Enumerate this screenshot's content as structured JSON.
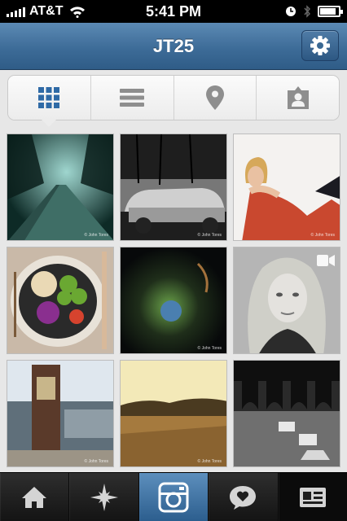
{
  "status_bar": {
    "carrier": "AT&T",
    "time": "5:41 PM",
    "battery_level": 0.85
  },
  "nav": {
    "title": "JT25",
    "settings_icon": "gear-icon"
  },
  "view_tabs": [
    {
      "name": "grid",
      "icon": "grid-icon",
      "active": true
    },
    {
      "name": "list",
      "icon": "list-icon",
      "active": false
    },
    {
      "name": "map",
      "icon": "map-pin-icon",
      "active": false
    },
    {
      "name": "tagged",
      "icon": "person-tag-icon",
      "active": false
    }
  ],
  "photos": [
    {
      "subject": "teal forest road",
      "video": false,
      "watermark": "© John Tores"
    },
    {
      "subject": "black and white car in snow",
      "video": false,
      "watermark": "© John Tores"
    },
    {
      "subject": "woman in red top",
      "video": false,
      "watermark": "© John Tores"
    },
    {
      "subject": "plate of food",
      "video": false,
      "watermark": ""
    },
    {
      "subject": "dark abstract",
      "video": false,
      "watermark": "© John Tores"
    },
    {
      "subject": "black and white portrait",
      "video": true,
      "watermark": ""
    },
    {
      "subject": "street kiosk",
      "video": false,
      "watermark": "© John Tores"
    },
    {
      "subject": "field landscape",
      "video": false,
      "watermark": "© John Tores"
    },
    {
      "subject": "courtyard black and white",
      "video": false,
      "watermark": ""
    }
  ],
  "tab_bar": [
    {
      "name": "home",
      "icon": "home-icon"
    },
    {
      "name": "explore",
      "icon": "star-icon"
    },
    {
      "name": "camera",
      "icon": "camera-icon"
    },
    {
      "name": "news",
      "icon": "heart-bubble-icon"
    },
    {
      "name": "profile",
      "icon": "profile-card-icon"
    }
  ]
}
